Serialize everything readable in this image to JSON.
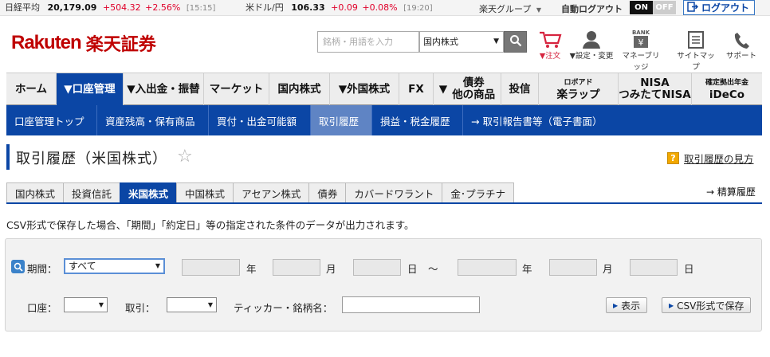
{
  "topbar": {
    "tickers": [
      {
        "name": "日経平均",
        "value": "20,179.09",
        "change": "+504.32",
        "pct": "+2.56%",
        "time": "[15:15]"
      },
      {
        "name": "米ドル/円",
        "value": "106.33",
        "change": "+0.09",
        "pct": "+0.08%",
        "time": "[19:20]"
      }
    ],
    "group_label": "楽天グループ",
    "auto_logout_label": "自動ログアウト",
    "on_label": "ON",
    "off_label": "OFF",
    "logout_label": "ログアウト"
  },
  "header": {
    "logo_latin": "Rakuten",
    "logo_jp": "楽天証券",
    "search_placeholder": "銘柄・用語を入力",
    "market_select": "国内株式",
    "icons": [
      {
        "icon": "cart-icon",
        "label": "▼注文"
      },
      {
        "icon": "user-icon",
        "label": "▼設定・変更"
      },
      {
        "icon": "bank-icon",
        "label": "マネーブリッジ"
      },
      {
        "icon": "sitemap-icon",
        "label": "サイトマップ"
      },
      {
        "icon": "phone-icon",
        "label": "サポート"
      }
    ],
    "bank_text": "BANK"
  },
  "nav": {
    "items": [
      {
        "label": "ホーム"
      },
      {
        "label": "▼口座管理"
      },
      {
        "label": "▼入出金・振替"
      },
      {
        "label": "マーケット"
      },
      {
        "label": "国内株式"
      },
      {
        "label": "▼外国株式"
      },
      {
        "label": "FX"
      },
      {
        "label": "▼",
        "line1": "債券",
        "line2": "他の商品"
      },
      {
        "label": "投信"
      },
      {
        "small": "ロボアド",
        "label": "楽ラップ"
      },
      {
        "line1": "NISA",
        "line2": "つみたてNISA"
      },
      {
        "small": "確定拠出年金",
        "label": "iDeCo"
      }
    ]
  },
  "subnav": {
    "items": [
      "口座管理トップ",
      "資産残高・保有商品",
      "買付・出金可能額",
      "取引履歴",
      "損益・税金履歴",
      "→ 取引報告書等（電子書面）"
    ]
  },
  "page": {
    "title": "取引履歴（米国株式）",
    "star": "☆",
    "help_q": "?",
    "help_link": "取引履歴の見方",
    "tabs": [
      "国内株式",
      "投資信託",
      "米国株式",
      "中国株式",
      "アセアン株式",
      "債券",
      "カバードワラント",
      "金･プラチナ"
    ],
    "seisan_link": "→ 精算履歴",
    "note": "CSV形式で保存した場合、「期間」「約定日」等の指定された条件のデータが出力されます。"
  },
  "form": {
    "period_label": "期間：",
    "period_value": "すべて",
    "year": "年",
    "month": "月",
    "day": "日",
    "tilde": "～",
    "account_label": "口座：",
    "trade_label": "取引：",
    "ticker_label": "ティッカー・銘柄名：",
    "show_button": "表示",
    "csv_button": "CSV形式で保存"
  },
  "colors": {
    "brand_red": "#bf0000",
    "nav_blue": "#0b46a5",
    "up_red": "#e0002a"
  }
}
